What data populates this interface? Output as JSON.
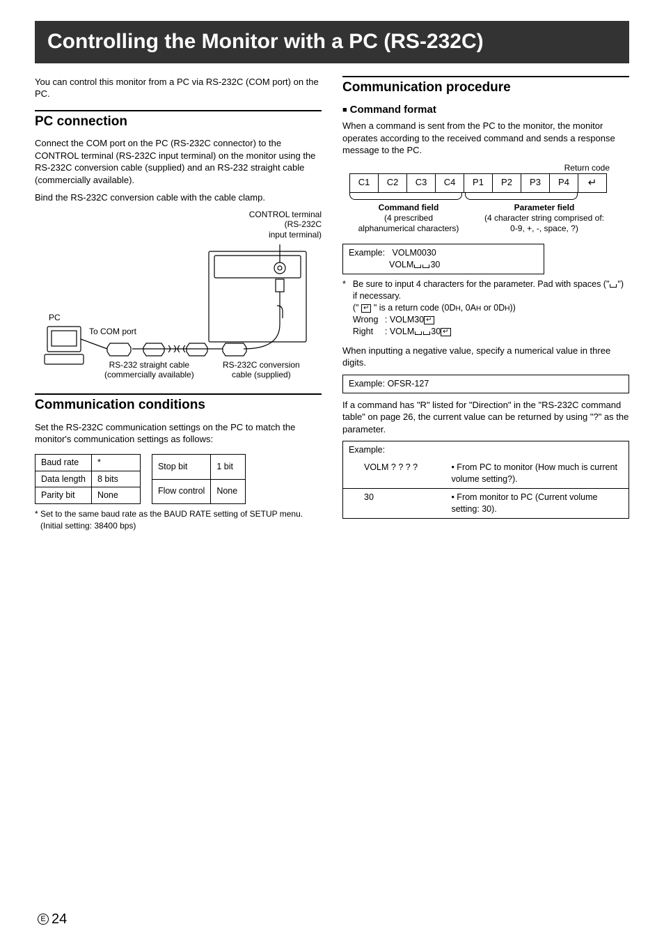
{
  "banner": "Controlling the Monitor with a PC (RS-232C)",
  "intro": "You can control this monitor from a PC via RS-232C (COM port) on the PC.",
  "pc": {
    "title": "PC connection",
    "p1": "Connect the COM port on the PC (RS-232C connector) to the CONTROL terminal (RS-232C input terminal) on the monitor using the RS-232C conversion cable (supplied) and an RS-232 straight cable (commercially available).",
    "p2": "Bind the RS-232C conversion cable with the cable clamp.",
    "labels": {
      "control": "CONTROL terminal\n(RS-232C\ninput terminal)",
      "pc": "PC",
      "tocom": "To COM port",
      "straight": "RS-232 straight cable\n(commercially available)",
      "conv": "RS-232C conversion\ncable (supplied)"
    }
  },
  "cond": {
    "title": "Communication conditions",
    "p1": "Set the RS-232C communication settings on the PC to match the monitor's communication settings as follows:",
    "tbl1": [
      [
        "Baud rate",
        "*"
      ],
      [
        "Data length",
        "8 bits"
      ],
      [
        "Parity bit",
        "None"
      ]
    ],
    "tbl2": [
      [
        "Stop bit",
        "1 bit"
      ],
      [
        "Flow control",
        "None"
      ]
    ],
    "foot": "* Set to the same baud rate as the BAUD RATE setting of SETUP menu. (Initial setting: 38400 bps)"
  },
  "proc": {
    "title": "Communication procedure",
    "fmt": {
      "title": "Command format",
      "p1": "When a command is sent from the PC to the monitor, the monitor operates according to the received command and sends a response message to the PC.",
      "retcode": "Return code",
      "cells": [
        "C1",
        "C2",
        "C3",
        "C4",
        "P1",
        "P2",
        "P3",
        "P4"
      ],
      "cmd_field": "Command field",
      "cmd_sub": "(4 prescribed\nalphanumerical characters)",
      "param_field": "Parameter field",
      "param_sub": "(4 character string comprised of:\n0-9, +, -, space, ?)",
      "example_label": "Example:",
      "example1": "VOLM0030",
      "example2_prefix": "VOLM",
      "example2_suffix": "30",
      "star1": "Be sure to input 4 characters for the parameter. Pad with spaces (\"",
      "star1b": "\") if necessary.",
      "star2a": "(\" ",
      "star2b": " \" is a return code (0D",
      "star2c": ", 0A",
      "star2d": " or 0D",
      "star2e": "))",
      "wrong_l": "Wrong",
      "wrong_v": "VOLM30",
      "right_l": "Right",
      "right_v_prefix": "VOLM",
      "right_v_suffix": "30"
    },
    "neg": "When inputting a negative value, specify a numerical value in three digits.",
    "neg_ex": "Example: OFSR-127",
    "rdir": "If a command has \"R\" listed for \"Direction\" in the \"RS-232C command table\" on page 26, the current value can be returned by using \"?\" as the parameter.",
    "ex3": {
      "hdr": "Example:",
      "q": "VOLM ? ? ? ?",
      "qdesc": "• From PC to monitor (How much is current volume setting?).",
      "a": "30",
      "adesc": "• From monitor to PC (Current volume setting: 30)."
    }
  },
  "page": "24"
}
